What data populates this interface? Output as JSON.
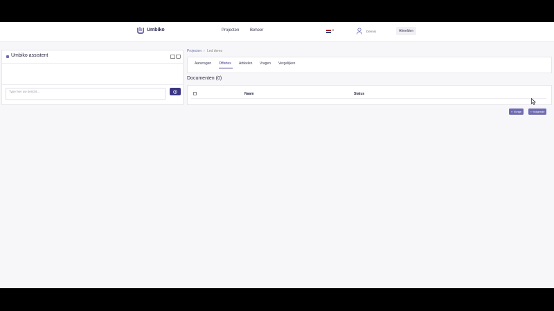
{
  "header": {
    "brand": "Umbiko",
    "nav": {
      "projects": "Projecten",
      "admin": "Beheer"
    },
    "user_name": "Dennis",
    "logout_label": "Afmelden"
  },
  "assistant": {
    "title": "Umbiko assistent",
    "input_placeholder": "Type hier uw bericht..."
  },
  "breadcrumb": {
    "root": "Projecten",
    "separator": "›",
    "current": "Led demo"
  },
  "tabs": [
    {
      "label": "Aanvragen",
      "active": false
    },
    {
      "label": "Offertes",
      "active": true
    },
    {
      "label": "Artikelen",
      "active": false
    },
    {
      "label": "Vragen",
      "active": false
    },
    {
      "label": "Vergelijken",
      "active": false
    }
  ],
  "documents": {
    "title": "Documenten (0)",
    "columns": [
      "Naam",
      "Status"
    ]
  },
  "pagination": {
    "prev_label": "‹‹ Vorige",
    "next_label": "›› Volgende"
  },
  "colors": {
    "accent": "#3a3583",
    "pager": "#6f6bb0",
    "background": "#f7f7f9",
    "frame": "#000000"
  },
  "icons": {
    "logo": "umbiko-logo-icon",
    "flag": "netherlands-flag-icon",
    "user": "user-icon",
    "send": "send-icon"
  }
}
